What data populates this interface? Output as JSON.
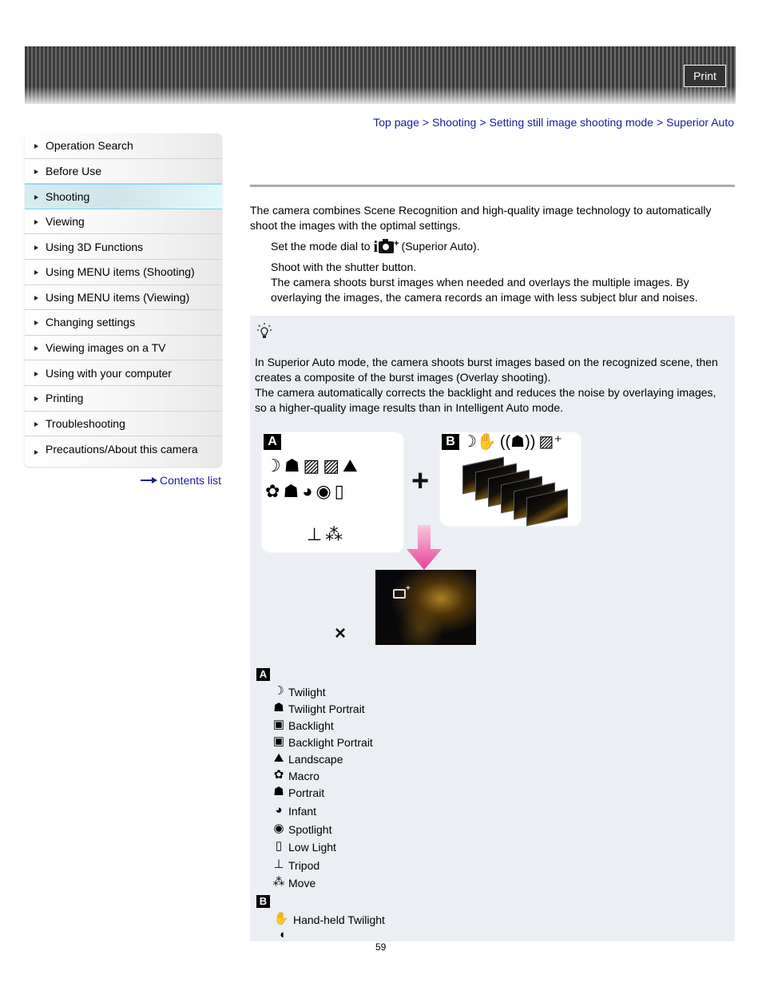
{
  "header": {
    "print_label": "Print"
  },
  "breadcrumb": {
    "items": [
      "Top page",
      "Shooting",
      "Setting still image shooting mode",
      "Superior Auto"
    ],
    "separator": ">"
  },
  "sidebar": {
    "items": [
      {
        "label": "Operation Search",
        "active": false
      },
      {
        "label": "Before Use",
        "active": false
      },
      {
        "label": "Shooting",
        "active": true
      },
      {
        "label": "Viewing",
        "active": false
      },
      {
        "label": "Using 3D Functions",
        "active": false
      },
      {
        "label": "Using MENU items (Shooting)",
        "active": false
      },
      {
        "label": "Using MENU items (Viewing)",
        "active": false
      },
      {
        "label": "Changing settings",
        "active": false
      },
      {
        "label": "Viewing images on a TV",
        "active": false
      },
      {
        "label": "Using with your computer",
        "active": false
      },
      {
        "label": "Printing",
        "active": false
      },
      {
        "label": "Troubleshooting",
        "active": false
      },
      {
        "label": "Precautions/About this camera",
        "active": false
      }
    ],
    "contents_link": "Contents list"
  },
  "main": {
    "title": "",
    "intro": "The camera combines Scene Recognition and high-quality image technology to automatically shoot the images with the optimal settings.",
    "steps": [
      {
        "before": "Set the mode dial to",
        "icon": "superior-auto-icon",
        "after": "(Superior Auto)."
      },
      {
        "text": "Shoot with the shutter button.",
        "detail": "The camera shoots burst images when needed and overlays the multiple images. By overlaying the images, the camera records an image with less subject blur and noises."
      }
    ]
  },
  "tip": {
    "icon": "hint-bulb-icon",
    "paragraphs": [
      "In Superior Auto mode, the camera shoots burst images based on the recognized scene, then creates a composite of the burst images (Overlay shooting).",
      "The camera automatically corrects the backlight and reduces the noise by overlaying images, so a higher-quality image results than in Intelligent Auto mode."
    ],
    "diagram": {
      "panel_a_label": "A",
      "panel_b_label": "B",
      "plus": "+",
      "times": "×",
      "panel_a_icons_row1": [
        "twilight-icon",
        "twilight-portrait-icon",
        "backlight-icon",
        "backlight-portrait-icon",
        "landscape-icon"
      ],
      "panel_a_icons_row2": [
        "macro-icon",
        "portrait-icon",
        "infant-icon",
        "spotlight-icon",
        "low-light-icon"
      ],
      "panel_a_icons_row3": [
        "tripod-icon",
        "move-icon"
      ],
      "panel_b_icons": [
        "hand-held-twilight-icon",
        "anti-motion-blur-icon",
        "backlight-correction-hdr-icon"
      ]
    },
    "list_a_label": "A",
    "list_a": [
      {
        "icon": "twilight-icon",
        "glyph": "☽",
        "label": "Twilight"
      },
      {
        "icon": "twilight-portrait-icon",
        "glyph": "☗",
        "label": "Twilight Portrait"
      },
      {
        "icon": "backlight-icon",
        "glyph": "▣",
        "label": "Backlight"
      },
      {
        "icon": "backlight-portrait-icon",
        "glyph": "▣",
        "label": "Backlight Portrait"
      },
      {
        "icon": "landscape-icon",
        "glyph": "⛰",
        "label": "Landscape"
      },
      {
        "icon": "macro-icon",
        "glyph": "✿",
        "label": "Macro"
      },
      {
        "icon": "portrait-icon",
        "glyph": "☗",
        "label": "Portrait"
      },
      {
        "icon": "infant-icon",
        "glyph": "◕",
        "label": "Infant"
      },
      {
        "icon": "spotlight-icon",
        "glyph": "◉",
        "label": "Spotlight"
      },
      {
        "icon": "low-light-icon",
        "glyph": "▯",
        "label": "Low Light"
      },
      {
        "icon": "tripod-icon",
        "glyph": "⊥",
        "label": "Tripod"
      },
      {
        "icon": "move-icon",
        "glyph": "⁂",
        "label": "Move"
      }
    ],
    "list_b_label": "B",
    "list_b": [
      {
        "icon": "hand-held-twilight-icon",
        "glyph": "✋",
        "label": "Hand-held Twilight"
      },
      {
        "icon": "anti-motion-blur-icon",
        "glyph": "◖",
        "label": ""
      }
    ]
  },
  "footer": {
    "page_number": "59"
  }
}
